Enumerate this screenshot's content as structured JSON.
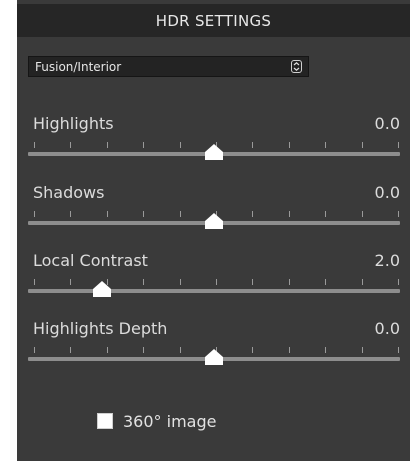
{
  "panel": {
    "title": "HDR SETTINGS",
    "preset": {
      "value": "Fusion/Interior",
      "icon": "chevron-updown-icon"
    },
    "sliders": [
      {
        "id": "highlights",
        "label": "Highlights",
        "value": "0.0",
        "level": 0.5
      },
      {
        "id": "shadows",
        "label": "Shadows",
        "value": "0.0",
        "level": 0.5
      },
      {
        "id": "local-contrast",
        "label": "Local Contrast",
        "value": "2.0",
        "level": 0.2
      },
      {
        "id": "highlights-depth",
        "label": "Highlights Depth",
        "value": "0.0",
        "level": 0.5
      }
    ],
    "image360": {
      "label": "360° image",
      "checked": false
    }
  },
  "colors": {
    "panel_bg": "#3a3a3a",
    "header_bg": "#262626",
    "text": "#dcdcdc",
    "track": "#8d8d8d",
    "thumb": "#ffffff"
  }
}
